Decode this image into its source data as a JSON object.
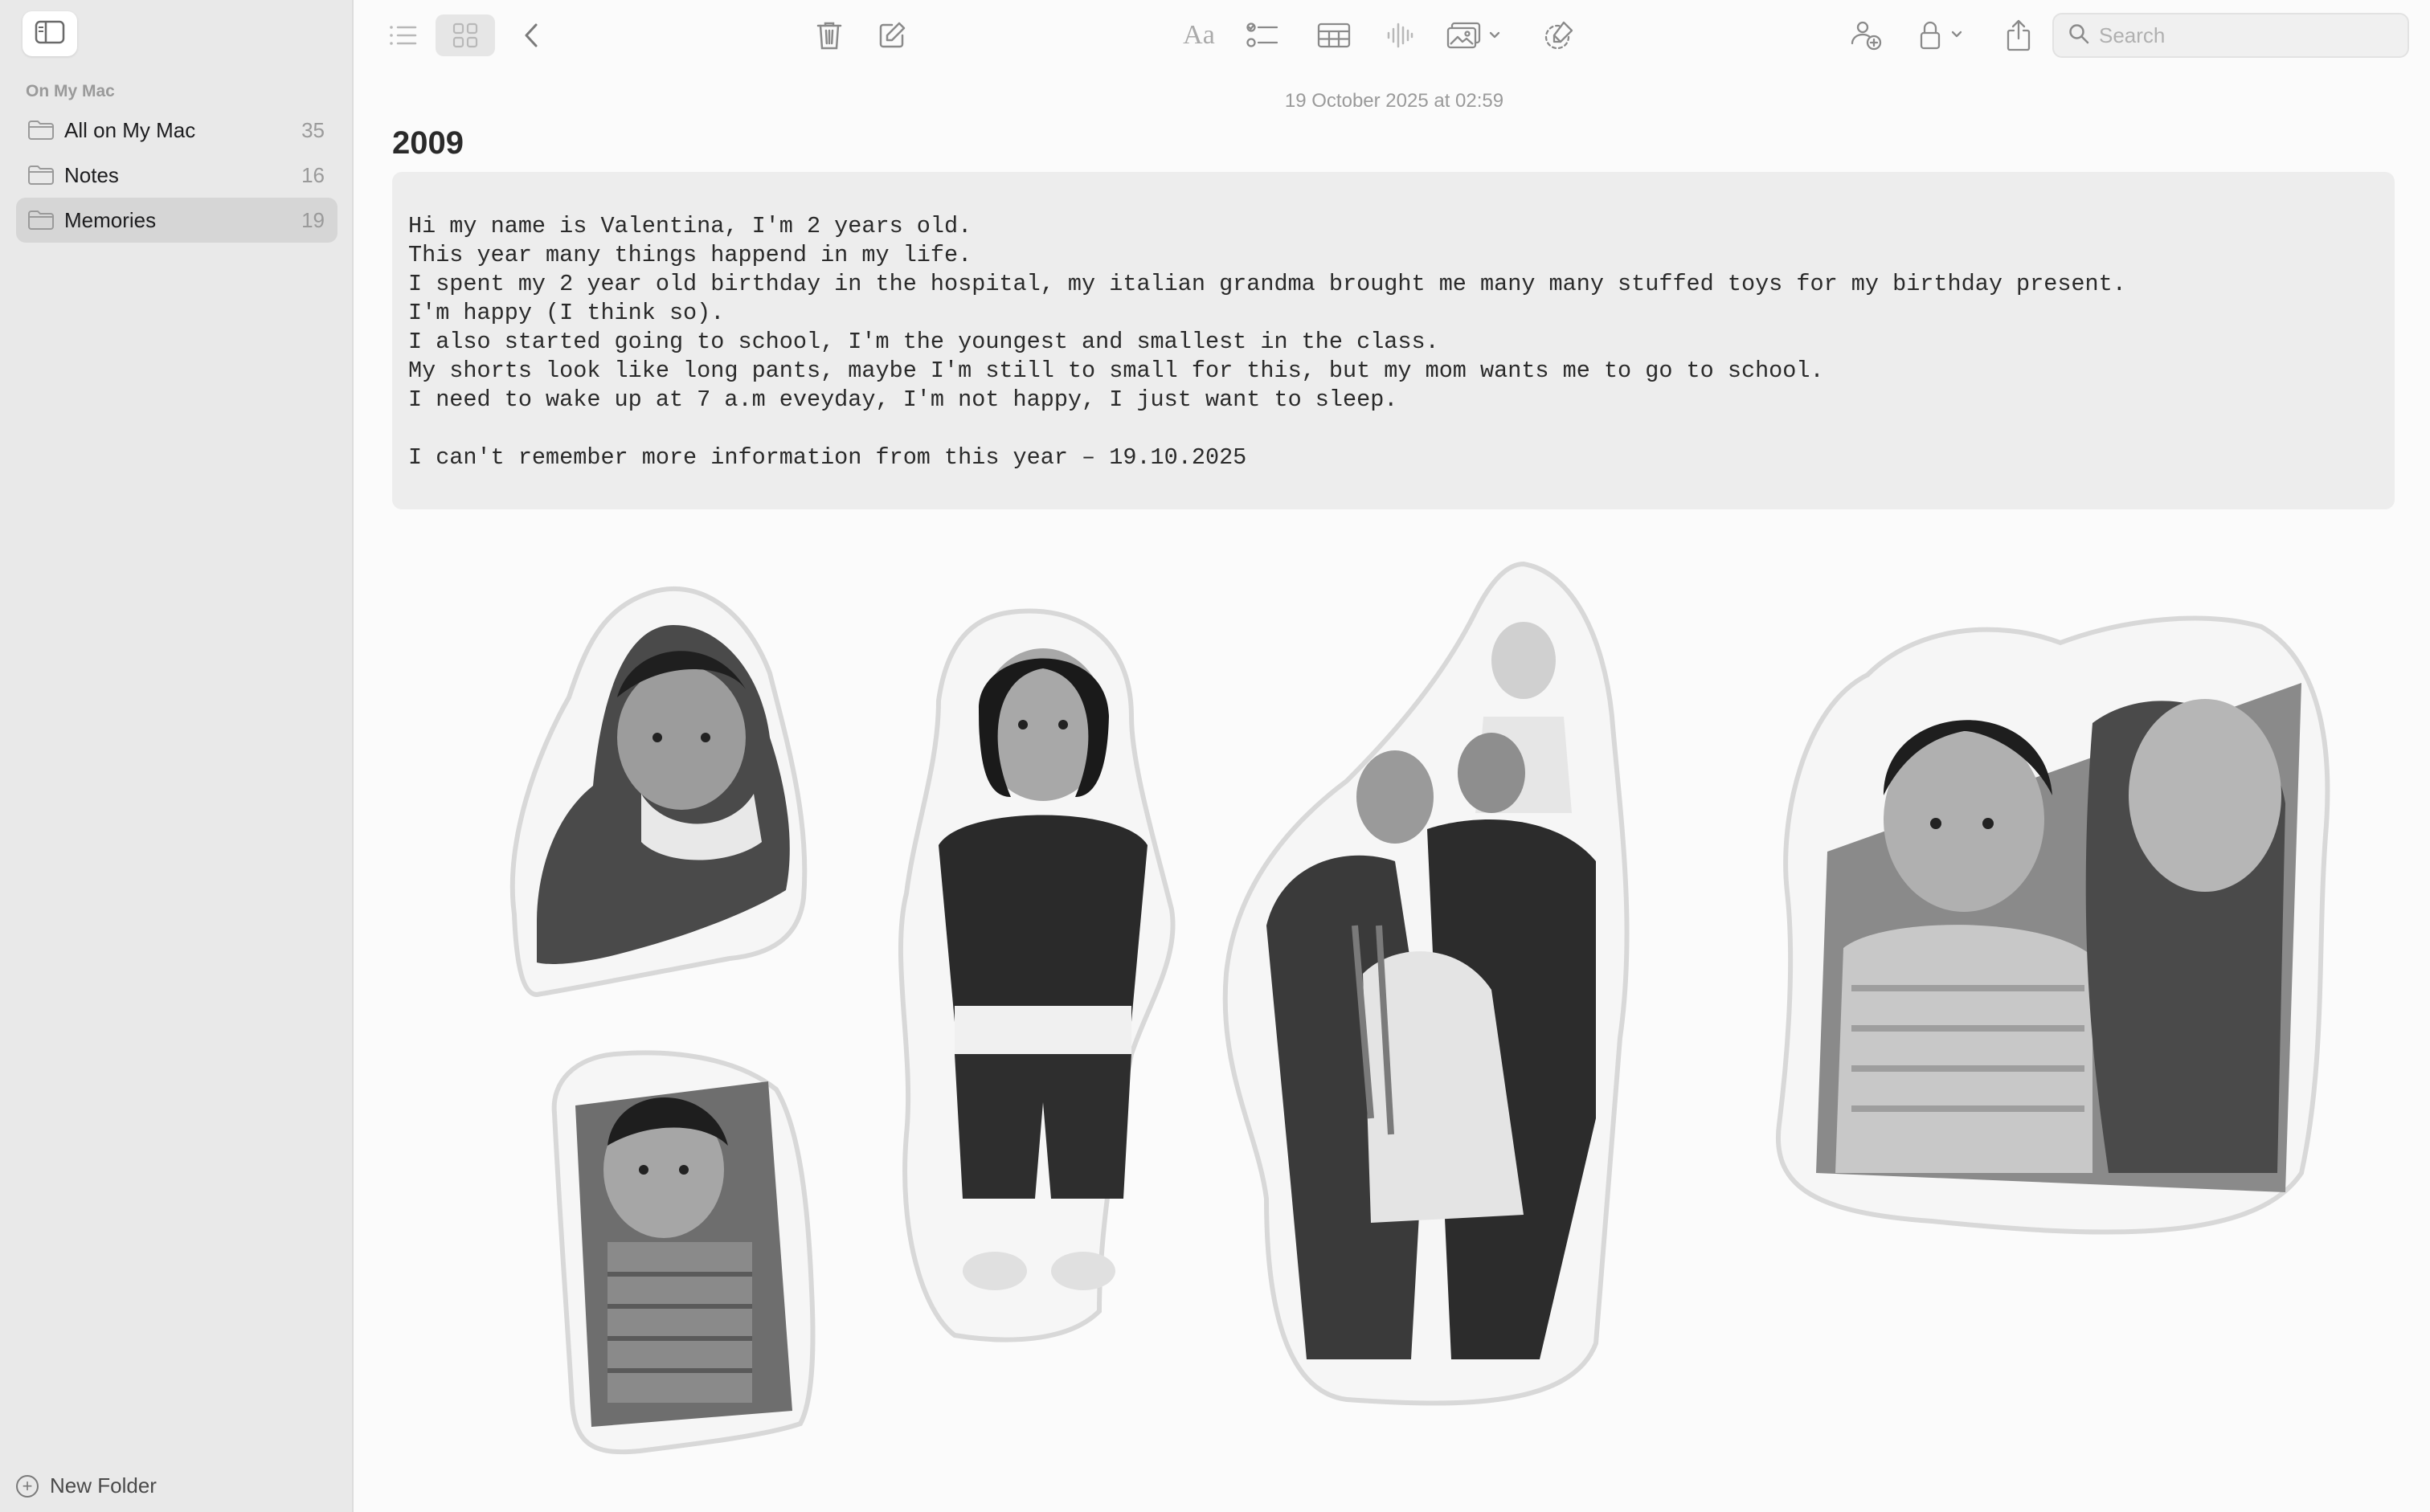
{
  "sidebar": {
    "toggle_icon": "sidebar-icon",
    "section_label": "On My Mac",
    "folders": [
      {
        "name": "All on My Mac",
        "count": "35"
      },
      {
        "name": "Notes",
        "count": "16"
      },
      {
        "name": "Memories",
        "count": "19",
        "selected": true
      }
    ],
    "new_folder_label": "New Folder"
  },
  "toolbar": {
    "icons": [
      "list-view-icon",
      "gallery-view-icon",
      "back-chevron-icon",
      "trash-icon",
      "compose-icon",
      "text-format-icon",
      "checklist-icon",
      "table-icon",
      "audio-icon",
      "media-icon",
      "markup-icon",
      "collaborate-icon",
      "lock-icon",
      "share-icon",
      "search-icon"
    ],
    "format_label": "Aa",
    "search_placeholder": "Search"
  },
  "note": {
    "date": "19 October 2025 at 02:59",
    "title": "2009",
    "lines": [
      "Hi my name is Valentina, I'm 2 years old.",
      "This year many things happend in my life.",
      "I spent my 2 year old birthday in the hospital, my italian grandma brought me many many stuffed toys for my birthday present.",
      "I'm happy (I think so).",
      "I also started going to school, I'm the youngest and smallest in the class.",
      "My shorts look like long pants, maybe I'm still to small for this, but my mom wants me to go to school.",
      "I need to wake up at 7 a.m eveyday, I'm not happy, I just want to sleep.",
      "",
      "I can't remember more information from this year – 19.10.2025"
    ]
  },
  "colors": {
    "sidebar_bg": "#e9e9e9",
    "selected_row": "#d6d6d6",
    "code_bg": "#ededed",
    "icon_gray": "#8a8a8a"
  }
}
